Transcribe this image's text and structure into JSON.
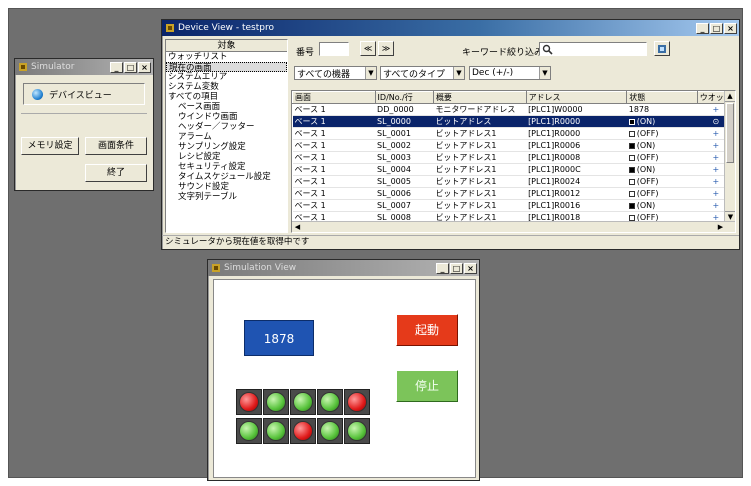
{
  "colors": {
    "desktop": "#6f6f6f",
    "titlebar_active": "#0a246a",
    "selection": "#0a246a",
    "numeric_display_bg": "#1f54b2",
    "start_button_bg": "#e53a1a",
    "stop_button_bg": "#7cc45a",
    "lamp_red": "#e01a1a",
    "lamp_green": "#56c23a"
  },
  "sim_window": {
    "title": "Simulator",
    "min": "_",
    "max": "□",
    "close": "×",
    "device_view_label": "デバイスビュー",
    "memory_settings": "メモリ設定",
    "screen_conditions": "画面条件",
    "exit": "終了"
  },
  "device_view": {
    "title": "Device View - testpro",
    "min": "_",
    "max": "□",
    "close": "×",
    "tree_header": "対象",
    "tree_items": [
      "ウォッチリスト",
      "現在の画面",
      "システムエリア",
      "システム変数",
      "すべての項目",
      "ベース画面",
      "ウインドウ画面",
      "ヘッダー／フッター",
      "アラーム",
      "サンプリング設定",
      "レシピ設定",
      "セキュリティ設定",
      "タイムスケジュール設定",
      "サウンド設定",
      "文字列テーブル"
    ],
    "number_label": "番号",
    "number_value": "",
    "prev_button": "≪",
    "next_button": "≫",
    "keyword_label": "キーワード絞り込み",
    "keyword_value": "",
    "filter_all_types": "すべての機器",
    "filter_all_kinds": "すべてのタイプ",
    "filter_format": "Dec (+/-)",
    "columns": [
      "画面",
      "ID/No./行",
      "概要",
      "アドレス",
      "状態",
      "ウオッチ"
    ],
    "rows": [
      {
        "screen": "ベース 1",
        "id": "DD_0000",
        "summary": "モニタワードアドレス",
        "address": "[PLC1]W0000",
        "state": "1878",
        "state_box": "",
        "watch": "+",
        "selected": false
      },
      {
        "screen": "ベース 1",
        "id": "SL_0000",
        "summary": "ビットアドレス",
        "address": "[PLC1]R0000",
        "state": "(ON)",
        "state_box": "on",
        "watch": "⊙",
        "selected": true
      },
      {
        "screen": "ベース 1",
        "id": "SL_0001",
        "summary": "ビットアドレス1",
        "address": "[PLC1]R0000",
        "state": "(OFF)",
        "state_box": "off",
        "watch": "+",
        "selected": false
      },
      {
        "screen": "ベース 1",
        "id": "SL_0002",
        "summary": "ビットアドレス1",
        "address": "[PLC1]R0006",
        "state": "(ON)",
        "state_box": "on",
        "watch": "+",
        "selected": false
      },
      {
        "screen": "ベース 1",
        "id": "SL_0003",
        "summary": "ビットアドレス1",
        "address": "[PLC1]R0008",
        "state": "(OFF)",
        "state_box": "off",
        "watch": "+",
        "selected": false
      },
      {
        "screen": "ベース 1",
        "id": "SL_0004",
        "summary": "ビットアドレス1",
        "address": "[PLC1]R000C",
        "state": "(ON)",
        "state_box": "on",
        "watch": "+",
        "selected": false
      },
      {
        "screen": "ベース 1",
        "id": "SL_0005",
        "summary": "ビットアドレス1",
        "address": "[PLC1]R0024",
        "state": "(OFF)",
        "state_box": "off",
        "watch": "+",
        "selected": false
      },
      {
        "screen": "ベース 1",
        "id": "SL_0006",
        "summary": "ビットアドレス1",
        "address": "[PLC1]R0012",
        "state": "(OFF)",
        "state_box": "off",
        "watch": "+",
        "selected": false
      },
      {
        "screen": "ベース 1",
        "id": "SL_0007",
        "summary": "ビットアドレス1",
        "address": "[PLC1]R0016",
        "state": "(ON)",
        "state_box": "on",
        "watch": "+",
        "selected": false
      },
      {
        "screen": "ベース 1",
        "id": "SL_0008",
        "summary": "ビットアドレス1",
        "address": "[PLC1]R0018",
        "state": "(OFF)",
        "state_box": "off",
        "watch": "+",
        "selected": false
      }
    ],
    "status_text": "シミュレータから現在値を取得中です"
  },
  "simulation_view": {
    "title": "Simulation View",
    "min": "_",
    "max": "□",
    "close": "×",
    "numeric_display": "1878",
    "start_button": "起動",
    "stop_button": "停止",
    "lamps": [
      "red",
      "green",
      "green",
      "green",
      "red",
      "green",
      "green",
      "red",
      "green",
      "green"
    ]
  }
}
